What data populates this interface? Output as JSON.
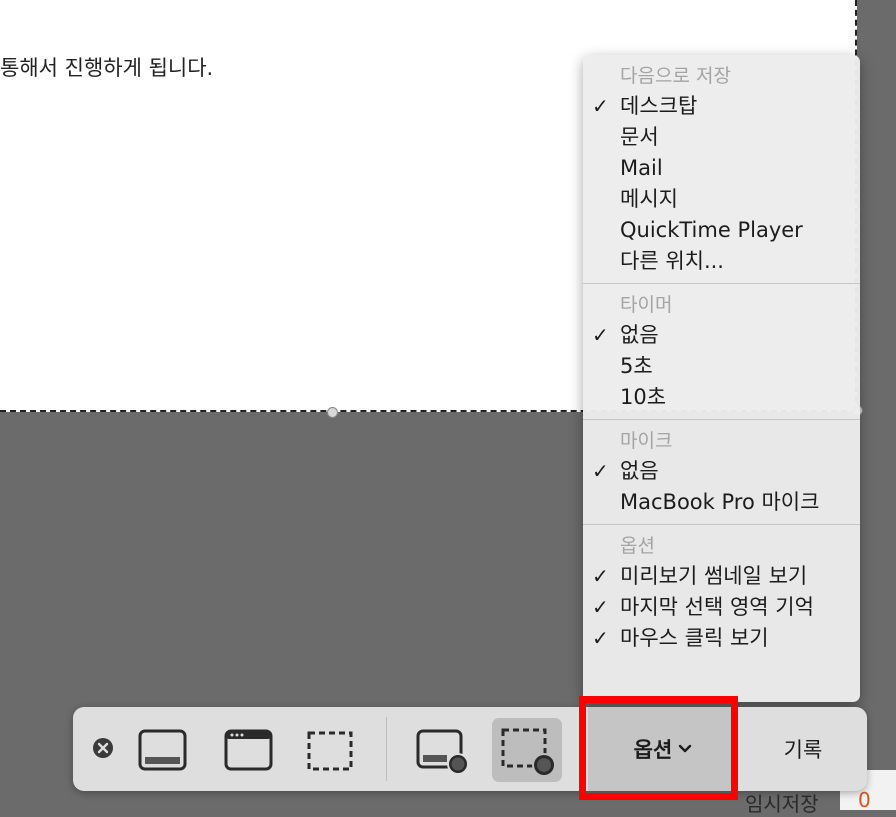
{
  "document": {
    "text": "통해서 진행하게 됩니다."
  },
  "menu": {
    "sections": [
      {
        "header": "다음으로 저장",
        "items": [
          {
            "label": "데스크탑",
            "checked": true
          },
          {
            "label": "문서",
            "checked": false
          },
          {
            "label": "Mail",
            "checked": false
          },
          {
            "label": "메시지",
            "checked": false
          },
          {
            "label": "QuickTime Player",
            "checked": false
          },
          {
            "label": "다른 위치...",
            "checked": false
          }
        ]
      },
      {
        "header": "타이머",
        "items": [
          {
            "label": "없음",
            "checked": true
          },
          {
            "label": "5초",
            "checked": false
          },
          {
            "label": "10초",
            "checked": false
          }
        ]
      },
      {
        "header": "마이크",
        "items": [
          {
            "label": "없음",
            "checked": true
          },
          {
            "label": "MacBook Pro 마이크",
            "checked": false
          }
        ]
      },
      {
        "header": "옵션",
        "items": [
          {
            "label": "미리보기 썸네일 보기",
            "checked": true
          },
          {
            "label": "마지막 선택 영역 기억",
            "checked": true
          },
          {
            "label": "마우스 클릭 보기",
            "checked": true
          }
        ]
      }
    ],
    "check_mark": "✓"
  },
  "toolbar": {
    "options_label": "옵션",
    "record_label": "기록",
    "selected_tool": "record-selected-portion",
    "icons": [
      "close-icon",
      "capture-entire-screen-icon",
      "capture-window-icon",
      "capture-selection-icon",
      "record-entire-screen-icon",
      "record-selection-icon"
    ]
  },
  "background_window": {
    "save_draft_label": "임시저장",
    "draft_count": "0"
  },
  "colors": {
    "highlight": "#ff0000",
    "accent_count": "#e0531d"
  }
}
